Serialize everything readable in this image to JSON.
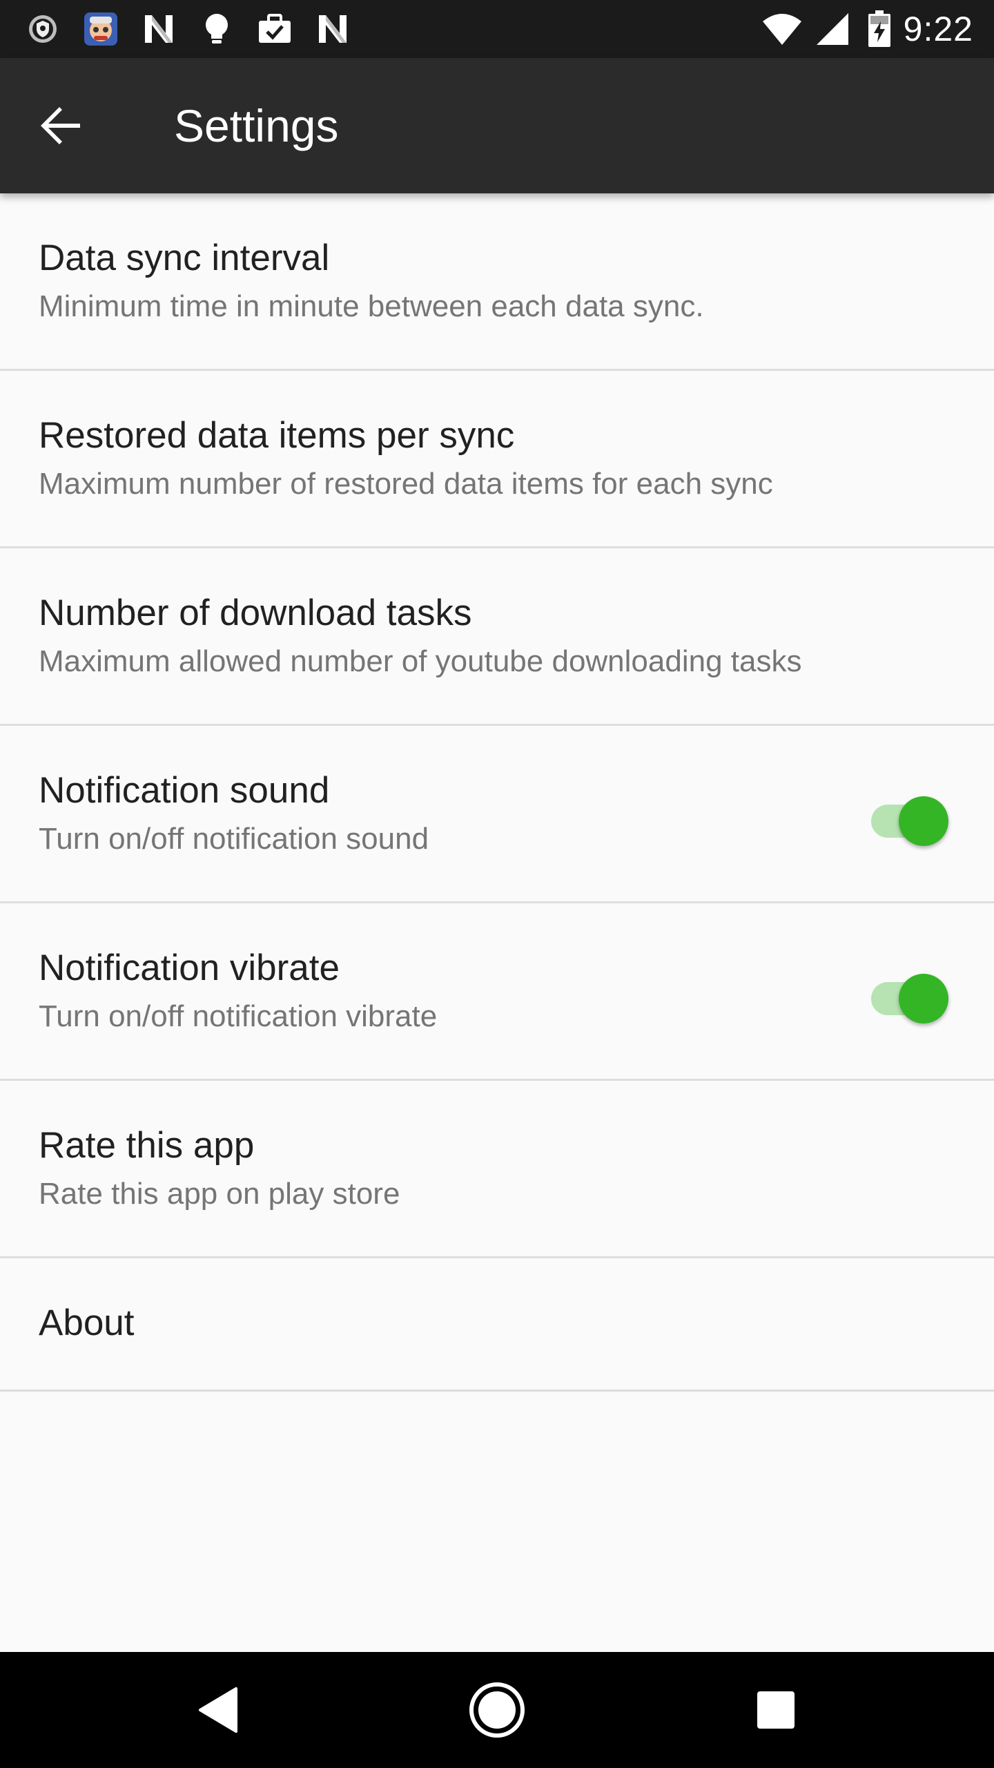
{
  "status_bar": {
    "time": "9:22",
    "icons_left": [
      "vpn-shield-icon",
      "app-avatar-icon",
      "n-app-icon",
      "lightbulb-icon",
      "briefcase-check-icon",
      "n-app-icon"
    ],
    "icons_right": [
      "wifi-icon",
      "cellular-signal-icon",
      "battery-charging-icon"
    ]
  },
  "app_bar": {
    "title": "Settings",
    "back_icon": "arrow-back-icon",
    "background": "#2b2b2b"
  },
  "settings": {
    "items": [
      {
        "title": "Data sync interval",
        "subtitle": "Minimum time in minute between each data sync."
      },
      {
        "title": "Restored data items per sync",
        "subtitle": "Maximum number of restored data items for each sync"
      },
      {
        "title": "Number of download tasks",
        "subtitle": "Maximum allowed number of youtube downloading tasks"
      },
      {
        "title": "Notification sound",
        "subtitle": "Turn on/off notification sound",
        "toggle": "on"
      },
      {
        "title": "Notification vibrate",
        "subtitle": "Turn on/off notification vibrate",
        "toggle": "on"
      },
      {
        "title": "Rate this app",
        "subtitle": "Rate this app on play store"
      },
      {
        "title": "About"
      }
    ]
  },
  "colors": {
    "toggle_on_thumb": "#34b526",
    "toggle_on_track": "#b6e3b1",
    "title_text": "#212121",
    "subtitle_text": "#757575"
  },
  "nav_bar": {
    "buttons": [
      "back-triangle-icon",
      "home-circle-icon",
      "recents-square-icon"
    ]
  }
}
